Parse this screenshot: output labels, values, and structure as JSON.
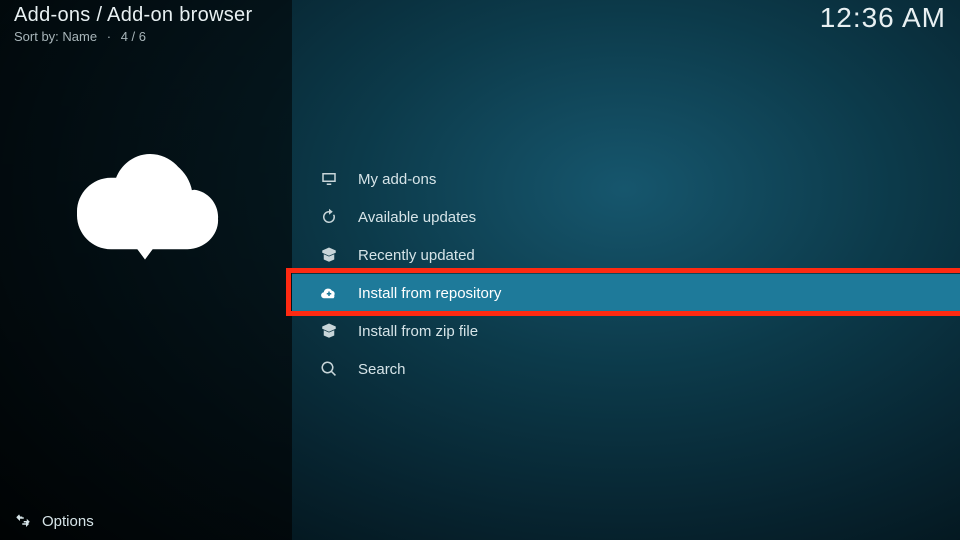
{
  "header": {
    "breadcrumb": "Add-ons / Add-on browser",
    "sort_label": "Sort by:",
    "sort_value": "Name",
    "position": "4 / 6"
  },
  "clock": "12:36 AM",
  "menu": {
    "items": [
      {
        "icon": "monitor-icon",
        "label": "My add-ons",
        "focused": false
      },
      {
        "icon": "refresh-icon",
        "label": "Available updates",
        "focused": false
      },
      {
        "icon": "open-box-icon",
        "label": "Recently updated",
        "focused": false
      },
      {
        "icon": "cloud-plus-icon",
        "label": "Install from repository",
        "focused": true
      },
      {
        "icon": "open-box-icon",
        "label": "Install from zip file",
        "focused": false
      },
      {
        "icon": "search-icon",
        "label": "Search",
        "focused": false
      }
    ]
  },
  "footer": {
    "options_label": "Options"
  },
  "annotation": {
    "highlight_index": 3
  }
}
